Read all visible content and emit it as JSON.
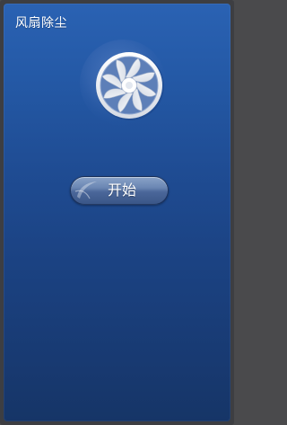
{
  "window": {
    "title": "风扇除尘"
  },
  "fan": {
    "icon": "fan-icon"
  },
  "actions": {
    "start_label": "开始"
  },
  "colors": {
    "panel_top": "#2a62b3",
    "panel_bottom": "#163567",
    "button_top": "#8aa3c8",
    "button_bottom": "#3a5688",
    "text": "#ffffff"
  }
}
